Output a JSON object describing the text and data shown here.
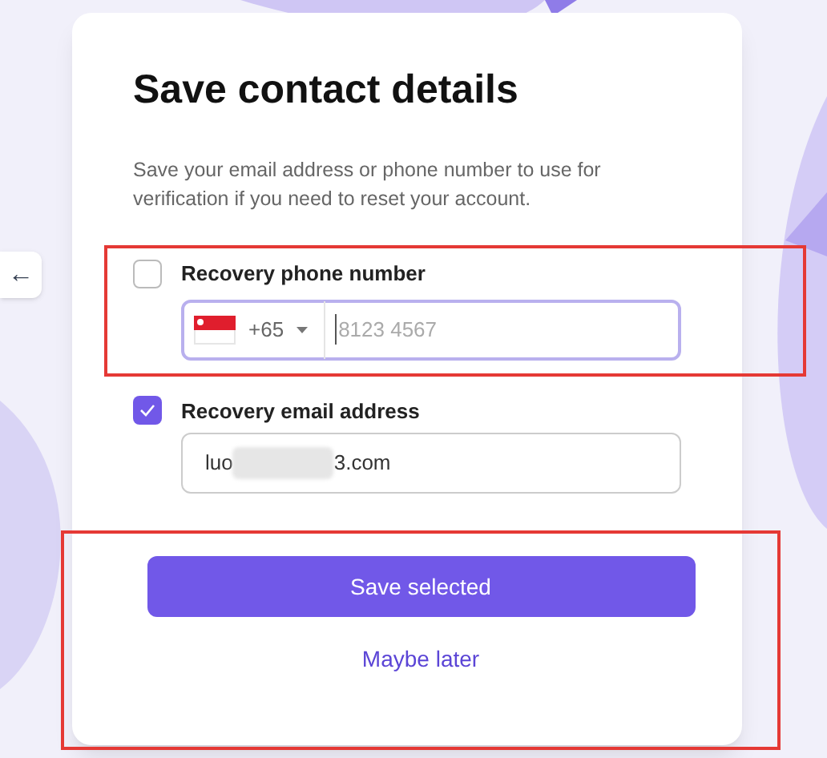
{
  "back_button": {
    "icon": "←"
  },
  "title": "Save contact details",
  "description": "Save your email address or phone number to use for verification if you need to reset your account.",
  "options": [
    {
      "kind": "phone",
      "label": "Recovery phone number",
      "checked": false,
      "highlighted": true,
      "country_code": "+65",
      "placeholder": "8123 4567"
    },
    {
      "kind": "email",
      "label": "Recovery email address",
      "checked": true,
      "highlighted": false,
      "value_start": "luo",
      "value_end": "3.com",
      "redacted": true
    }
  ],
  "actions": {
    "highlighted": true,
    "primary": "Save selected",
    "secondary": "Maybe later"
  }
}
